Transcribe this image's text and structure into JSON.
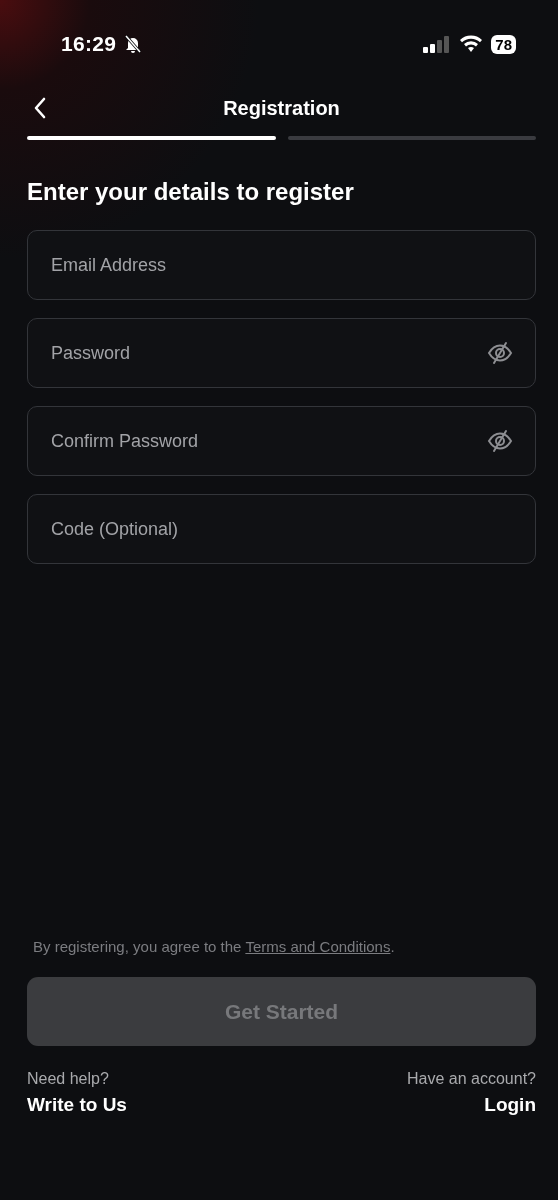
{
  "status_bar": {
    "time": "16:29",
    "battery": "78"
  },
  "header": {
    "title": "Registration"
  },
  "progress": [
    {
      "selected": true
    },
    {
      "selected": false
    }
  ],
  "heading": "Enter your details to register",
  "fields": [
    {
      "kind": "text",
      "placeholder": "Email Address"
    },
    {
      "kind": "password",
      "placeholder": "Password"
    },
    {
      "kind": "password",
      "placeholder": "Confirm Password"
    },
    {
      "kind": "text",
      "placeholder": "Code (Optional)"
    }
  ],
  "terms": {
    "text": "By registering, you agree to the",
    "link": "Terms and Conditions",
    "end": "."
  },
  "submit": {
    "label": "Get Started",
    "disabled": true
  },
  "footer": {
    "help_prompt": "Need help?",
    "help_link": "Write to Us",
    "account_prompt": "Have an account?",
    "account_link": "Login"
  }
}
